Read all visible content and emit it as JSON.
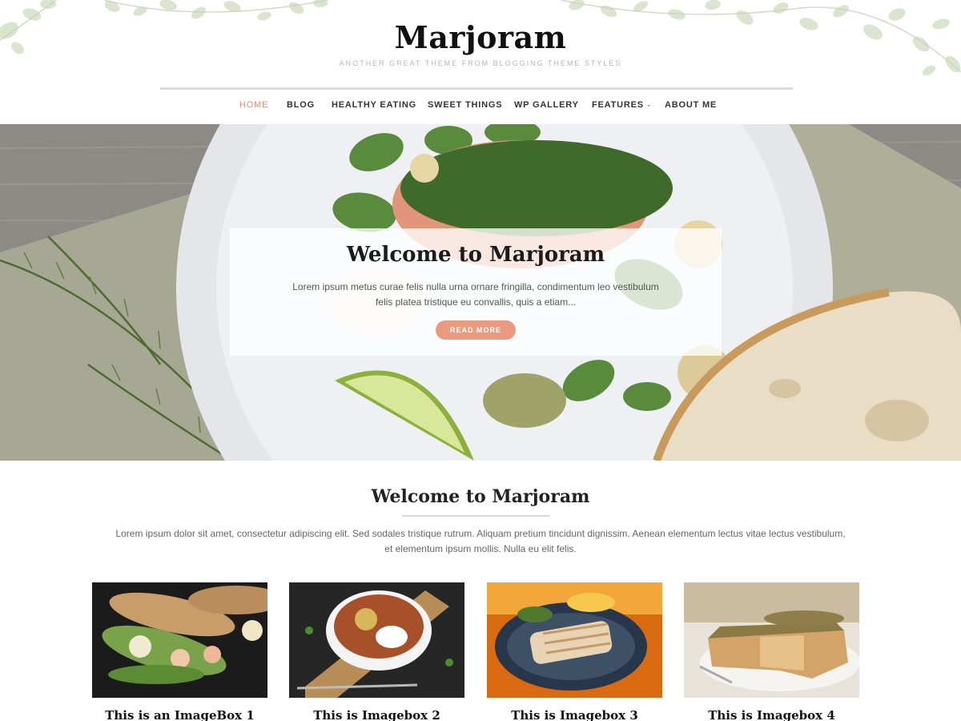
{
  "site": {
    "title": "Marjoram",
    "tagline": "ANOTHER GREAT THEME FROM BLOGGING THEME STYLES"
  },
  "nav": {
    "items": [
      {
        "label": "HOME",
        "active": true
      },
      {
        "label": "BLOG"
      },
      {
        "label": "HEALTHY EATING"
      },
      {
        "label": "SWEET THINGS"
      },
      {
        "label": "WP GALLERY"
      },
      {
        "label": "FEATURES",
        "has_dropdown": true
      },
      {
        "label": "ABOUT ME"
      }
    ],
    "dropdown_icon": "chevron-down-icon"
  },
  "hero": {
    "title": "Welcome to Marjoram",
    "text": "Lorem ipsum metus curae felis nulla urna ornare fringilla, condimentum leo vestibulum felis platea tristique eu convallis, quis a etiam...",
    "button_label": "READ MORE",
    "image": "salmon-plate-photo"
  },
  "welcome": {
    "title": "Welcome to Marjoram",
    "text": "Lorem ipsum dolor sit amet, consectetur adipiscing elit. Sed sodales tristique rutrum. Aliquam pretium tincidunt dignissim. Aenean elementum lectus vitae lectus vestibulum, et elementum ipsum mollis. Nulla eu elit felis."
  },
  "imageboxes": [
    {
      "title": "This is an ImageBox 1",
      "image": "sandwich-photo"
    },
    {
      "title": "This is Imagebox 2",
      "image": "soup-bowl-photo"
    },
    {
      "title": "This is Imagebox 3",
      "image": "grilled-fish-photo"
    },
    {
      "title": "This is Imagebox 4",
      "image": "quiche-photo"
    }
  ],
  "colors": {
    "accent": "#e48a6c",
    "button": "#ec9a7f",
    "heading": "#111111",
    "body_text": "#666666"
  }
}
